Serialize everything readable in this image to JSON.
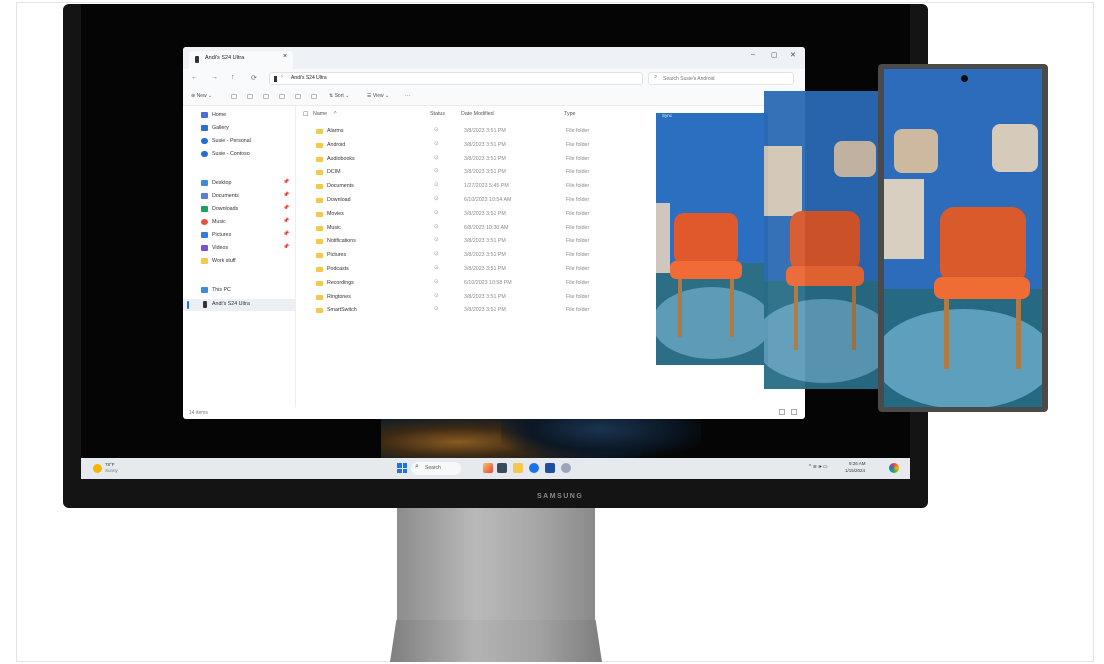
{
  "window": {
    "tab_title": "Andi's S24 Ultra",
    "tab_close": "×",
    "controls": [
      "–",
      "▢",
      "✕"
    ]
  },
  "address": {
    "nav": [
      "←",
      "→",
      "↑",
      "⟳"
    ],
    "path": "Andi's S24 Ultra",
    "search_placeholder": "Search Susie's Android",
    "search_icon": "⌕"
  },
  "toolbar": {
    "new_label": "⊕  New ⌄",
    "sort_label": "⇅  Sort ⌄",
    "view_label": "☰  View ⌄",
    "more_label": "···"
  },
  "sidebar": {
    "items": [
      {
        "label": "Home",
        "icon": "home-icon",
        "color": "#4a6fd8"
      },
      {
        "label": "Gallery",
        "icon": "gallery-icon",
        "color": "#2d6fd0"
      },
      {
        "label": "Susie - Personal",
        "icon": "cloud-icon",
        "color": "#1f6fd6"
      },
      {
        "label": "Susie - Contoso",
        "icon": "cloud-icon",
        "color": "#1f6fd6"
      },
      {
        "label": "Desktop",
        "icon": "desktop-icon",
        "color": "#3b8be0"
      },
      {
        "label": "Documents",
        "icon": "documents-icon",
        "color": "#5c7cdb"
      },
      {
        "label": "Downloads",
        "icon": "downloads-icon",
        "color": "#1aa260"
      },
      {
        "label": "Music",
        "icon": "music-icon",
        "color": "#e5533d"
      },
      {
        "label": "Pictures",
        "icon": "pictures-icon",
        "color": "#2f7fd8"
      },
      {
        "label": "Videos",
        "icon": "videos-icon",
        "color": "#7a4fd1"
      },
      {
        "label": "Work stuff",
        "icon": "folder-icon",
        "color": "#f2c94c"
      },
      {
        "label": "This PC",
        "icon": "pc-icon",
        "color": "#3b8be0"
      },
      {
        "label": "Andi's S24 Ultra",
        "icon": "phone-icon",
        "color": "#333333"
      }
    ],
    "pin": "📌"
  },
  "columns": {
    "name": "Name",
    "sort_arrow": "^",
    "status": "Status",
    "date": "Date Modified",
    "type": "Type"
  },
  "files": [
    {
      "name": "Alarms",
      "status": "⊙",
      "date": "3/8/2023 3:51 PM",
      "type": "File folder"
    },
    {
      "name": "Android",
      "status": "⊙",
      "date": "3/8/2023 3:51 PM",
      "type": "File folder"
    },
    {
      "name": "Audiobooks",
      "status": "⊙",
      "date": "3/8/2023 3:51 PM",
      "type": "File folder"
    },
    {
      "name": "DCIM",
      "status": "⊙",
      "date": "3/8/2023 3:51 PM",
      "type": "File folder"
    },
    {
      "name": "Documents",
      "status": "⊙",
      "date": "1/27/2023 5:45 PM",
      "type": "File folder"
    },
    {
      "name": "Download",
      "status": "⊙",
      "date": "6/10/2023 10:54 AM",
      "type": "File folder"
    },
    {
      "name": "Movies",
      "status": "⊙",
      "date": "3/8/2023 3:51 PM",
      "type": "File folder"
    },
    {
      "name": "Music",
      "status": "⊙",
      "date": "6/8/2023 10:30 AM",
      "type": "File folder"
    },
    {
      "name": "Notifications",
      "status": "⊙",
      "date": "3/8/2023 3:51 PM",
      "type": "File folder"
    },
    {
      "name": "Pictures",
      "status": "⊙",
      "date": "3/8/2023 3:51 PM",
      "type": "File folder"
    },
    {
      "name": "Podcasts",
      "status": "⊙",
      "date": "3/8/2023 3:51 PM",
      "type": "File folder"
    },
    {
      "name": "Recordings",
      "status": "⊙",
      "date": "6/10/2023 10:58 PM",
      "type": "File folder"
    },
    {
      "name": "Ringtones",
      "status": "⊙",
      "date": "3/8/2023 3:51 PM",
      "type": "File folder"
    },
    {
      "name": "SmartSwitch",
      "status": "⊙",
      "date": "3/8/2023 3:51 PM",
      "type": "File folder"
    }
  ],
  "status_bar": {
    "count": "14 items"
  },
  "taskbar": {
    "weather_temp": "78°F",
    "weather_desc": "Sunny",
    "search_icon": "⌕",
    "search_label": "Search",
    "tray": "^   ≋  🕪  ▭",
    "time": "9:26 AM",
    "date": "1/15/2024"
  },
  "monitor": {
    "brand": "SAMSUNG"
  },
  "photo_label": "Sync"
}
